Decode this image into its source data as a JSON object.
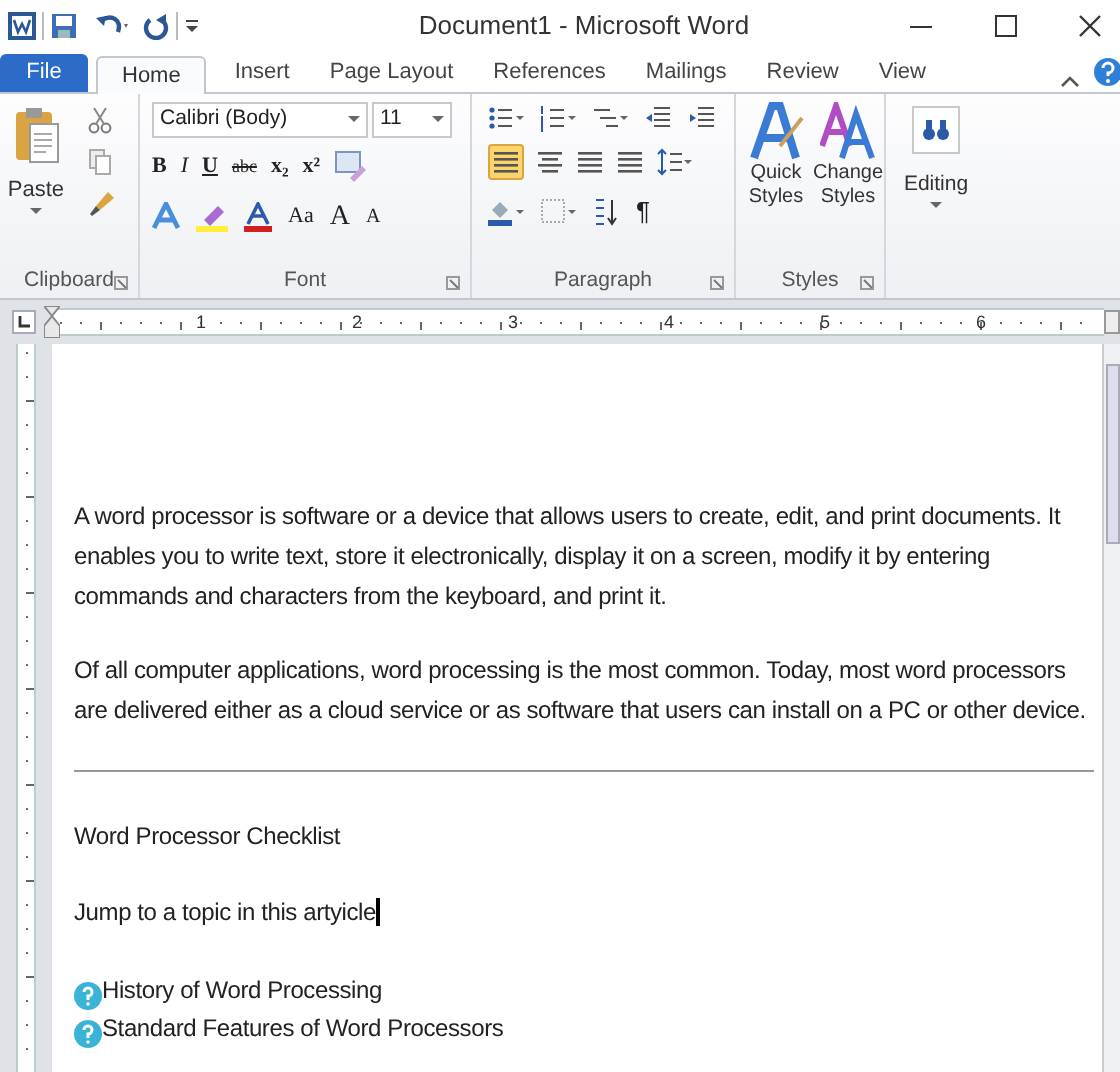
{
  "window": {
    "title": "Document1 - Microsoft Word"
  },
  "tabs": [
    {
      "label": "File",
      "kind": "file",
      "selected": false
    },
    {
      "label": "Home",
      "kind": "tab",
      "selected": true
    },
    {
      "label": "Insert",
      "kind": "tab",
      "selected": false
    },
    {
      "label": "Page Layout",
      "kind": "tab",
      "selected": false
    },
    {
      "label": "References",
      "kind": "tab",
      "selected": false
    },
    {
      "label": "Mailings",
      "kind": "tab",
      "selected": false
    },
    {
      "label": "Review",
      "kind": "tab",
      "selected": false
    },
    {
      "label": "View",
      "kind": "tab",
      "selected": false
    }
  ],
  "ribbon": {
    "clipboard": {
      "label": "Clipboard",
      "paste": "Paste"
    },
    "font": {
      "label": "Font",
      "name": "Calibri (Body)",
      "size": "11",
      "bold": "B",
      "italic": "I",
      "underline": "U",
      "strike": "abc",
      "subscript": "x₂",
      "superscript": "x²",
      "change_case": "Aa",
      "grow": "A",
      "shrink": "A"
    },
    "paragraph": {
      "label": "Paragraph",
      "pilcrow": "¶"
    },
    "styles": {
      "label": "Styles",
      "quick": "Quick Styles",
      "change": "Change Styles"
    },
    "editing": {
      "label": "Editing"
    }
  },
  "ruler": {
    "marks": [
      "1",
      "2",
      "3",
      "4",
      "5",
      "6"
    ]
  },
  "document": {
    "paragraphs": [
      "A word processor is software or a device that allows users to create, edit, and print documents. It enables you to write text, store it electronically, display it on a screen, modify it by entering commands and characters from the keyboard, and print it.",
      "Of all computer applications, word processing is the most common. Today, most word processors are delivered either as a cloud service or as software that users can install on a PC or other device."
    ],
    "heading": "Word Processor Checklist",
    "jump": "Jump to a topic in this artyicle",
    "links": [
      "History of Word Processing",
      "Standard Features of Word Processors"
    ]
  }
}
